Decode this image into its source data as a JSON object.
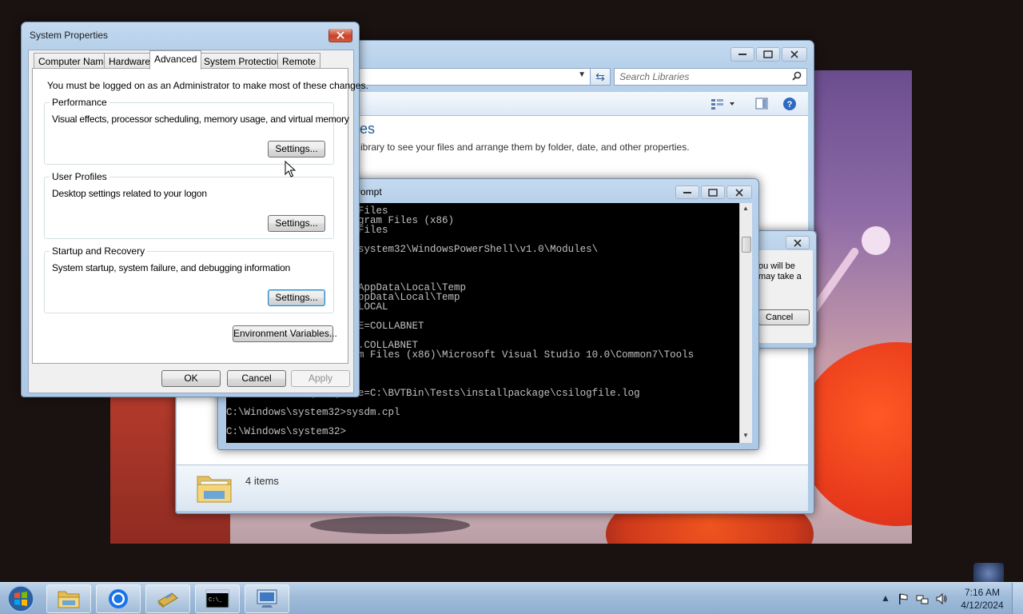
{
  "explorer": {
    "search_placeholder": "Search Libraries",
    "library_title": "ies",
    "library_description": "ibrary to see your files and arrange them by folder, date, and other properties.",
    "status_items": "4 items"
  },
  "background_dialog": {
    "text_line1": "ou will be",
    "text_line2": "may take a",
    "cancel_label": "Cancel"
  },
  "cmd": {
    "title": "rompt",
    "lines": [
      "                   am Files",
      "                   Program Files (x86)",
      "                   am Files",
      "",
      "                   ws\\system32\\WindowsPowerShell\\v1.0\\Modules\\",
      "                   c",
      "",
      "",
      "                   OL\\AppData\\Local\\Temp",
      "                   L\\AppData\\Local\\Temp",
      "                   ET.LOCAL",
      "",
      "                   FILE=COLLABNET",
      "",
      "                   VM1.COLLABNET",
      "                   gram Files (x86)\\Microsoft Visual Studio 10.0\\Common7\\Tools",
      "",
      "",
      "                   =3",
      "windows_tracing_logfile=C:\\BVTBin\\Tests\\installpackage\\csilogfile.log",
      "",
      "C:\\Windows\\system32>sysdm.cpl",
      "",
      "C:\\Windows\\system32>"
    ]
  },
  "sysprops": {
    "title": "System Properties",
    "tabs": [
      "Computer Name",
      "Hardware",
      "Advanced",
      "System Protection",
      "Remote"
    ],
    "active_tab": "Advanced",
    "admin_note": "You must be logged on as an Administrator to make most of these changes.",
    "performance": {
      "title": "Performance",
      "description": "Visual effects, processor scheduling, memory usage, and virtual memory",
      "button": "Settings..."
    },
    "user_profiles": {
      "title": "User Profiles",
      "description": "Desktop settings related to your logon",
      "button": "Settings..."
    },
    "startup_recovery": {
      "title": "Startup and Recovery",
      "description": "System startup, system failure, and debugging information",
      "button": "Settings..."
    },
    "env_button": "Environment Variables...",
    "ok": "OK",
    "cancel": "Cancel",
    "apply": "Apply"
  },
  "taskbar": {
    "items": [
      "windows-explorer",
      "chrome",
      "file-manager",
      "command-prompt",
      "remote-desktop"
    ],
    "time": "7:16 AM",
    "date": "4/12/2024"
  },
  "colors": {
    "title_accent": "#1e5c9c",
    "console_bg": "#000000",
    "console_text": "#c0c0c0"
  }
}
